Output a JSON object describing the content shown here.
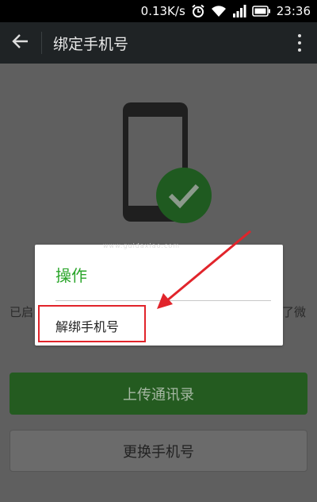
{
  "status_bar": {
    "network_speed": "0.13K/s",
    "time": "23:36",
    "icons": [
      "alarm-icon",
      "wifi-icon",
      "signal-icon",
      "battery-icon"
    ]
  },
  "action_bar": {
    "title": "绑定手机号",
    "back_icon": "arrow-left-icon",
    "menu_icon": "more-vert-icon"
  },
  "content": {
    "illustration": "phone-with-check",
    "hint_left": "已启",
    "hint_right": "了微",
    "buttons": {
      "upload_contacts": "上传通讯录",
      "change_number": "更换手机号"
    }
  },
  "dialog": {
    "title": "操作",
    "items": [
      "解绑手机号"
    ],
    "watermark": "www.guidaxiao.com"
  },
  "colors": {
    "accent_green": "#2aa52a",
    "button_green": "#245b20",
    "highlight_red": "#e1242b",
    "action_bar": "#1f2325"
  }
}
